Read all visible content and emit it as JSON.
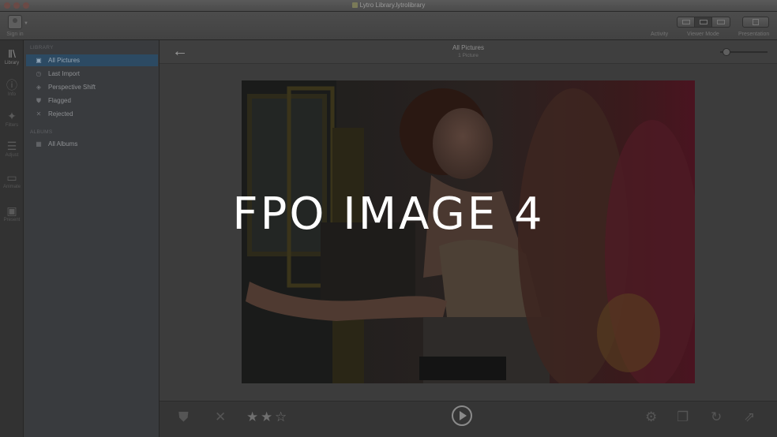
{
  "window": {
    "title": "Lytro Library.lytrolibrary"
  },
  "toolbar": {
    "signin_label": "Sign in",
    "activity_label": "Activity",
    "viewer_mode_label": "Viewer Mode",
    "presentation_label": "Presentation"
  },
  "rail": [
    {
      "label": "Library",
      "icon": "library-icon"
    },
    {
      "label": "Info",
      "icon": "info-icon"
    },
    {
      "label": "Filters",
      "icon": "filters-icon"
    },
    {
      "label": "Adjust",
      "icon": "adjust-icon"
    },
    {
      "label": "Animate",
      "icon": "animate-icon"
    },
    {
      "label": "Present",
      "icon": "present-icon"
    }
  ],
  "sidebar": {
    "library_header": "LIBRARY",
    "albums_header": "ALBUMS",
    "items": [
      {
        "label": "All Pictures",
        "icon": "pictures-icon",
        "selected": true
      },
      {
        "label": "Last Import",
        "icon": "clock-icon"
      },
      {
        "label": "Perspective Shift",
        "icon": "perspective-icon"
      },
      {
        "label": "Flagged",
        "icon": "flag-icon"
      },
      {
        "label": "Rejected",
        "icon": "x-icon"
      }
    ],
    "albums": [
      {
        "label": "All Albums",
        "icon": "grid-icon"
      }
    ]
  },
  "main": {
    "title": "All Pictures",
    "subtitle": "1 Picture",
    "zoom_level": 0.05
  },
  "overlay": {
    "text": "FPO IMAGE 4"
  },
  "bottombar": {
    "rating": 2,
    "rating_max": 3
  },
  "colors": {
    "selection": "#2c4a63",
    "overlay_text": "#ffffff"
  }
}
